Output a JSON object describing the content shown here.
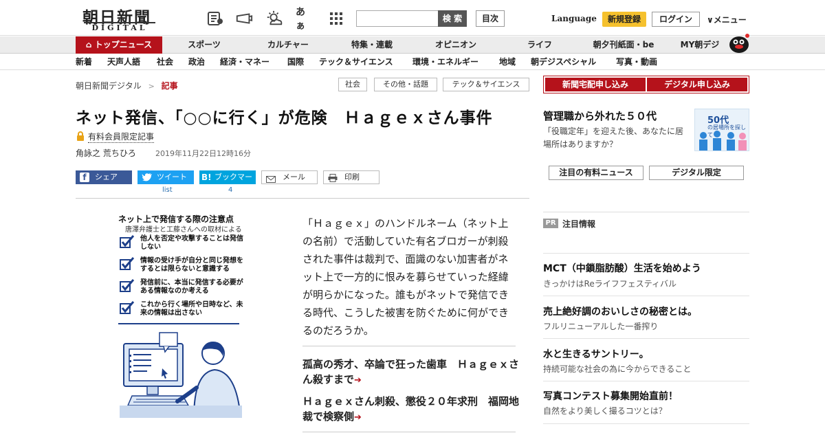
{
  "header": {
    "logo_main": "朝日新聞",
    "logo_sub": "DIGITAL",
    "kana_icon_text": "あぁ",
    "search_button": "検 索",
    "index_button": "目次",
    "language": "Language",
    "signup": "新規登録",
    "login": "ログイン",
    "menu": "∨メニュー"
  },
  "nav_primary": [
    "トップニュース",
    "スポーツ",
    "カルチャー",
    "特集・連載",
    "オピニオン",
    "ライフ",
    "朝夕刊紙面・be",
    "MY朝デジ"
  ],
  "nav_secondary": [
    "新着",
    "天声人語",
    "社会",
    "政治",
    "経済・マネー",
    "国際",
    "テック＆サイエンス",
    "環境・エネルギー",
    "地域",
    "朝デジスペシャル",
    "写真・動画"
  ],
  "breadcrumb": {
    "home": "朝日新聞デジタル",
    "sep": ">",
    "current": "記事"
  },
  "tags": [
    "社会",
    "その他・話題",
    "テック＆サイエンス"
  ],
  "article": {
    "title": "ネット発信、「○○に行く」が危険　Ｈａｇｅｘさん事件",
    "paid_label": "有料会員限定記事",
    "author": "角詠之 荒ちひろ",
    "date": "2019年11月22日12時16分",
    "share": {
      "facebook": "シェア",
      "twitter": "ツイート",
      "hatena": "ブックマーク",
      "hatena_mark": "B!",
      "mail": "メール",
      "print": "印刷",
      "twitter_count": "list",
      "hatena_count": "4"
    },
    "body": "「Ｈａｇｅｘ」のハンドルネーム（ネット上の名前）で活動していた有名ブロガーが刺殺された事件は裁判で、面識のない加害者がネット上で一方的に恨みを募らせていった経緯が明らかになった。誰もがネットで発信できる時代、こうした被害を防ぐために何ができるのだろうか。",
    "related": [
      "孤高の秀才、卒論で狂った歯車　Ｈａｇｅｘさん殺すまで",
      "Ｈａｇｅｘさん刺殺、懲役２０年求刑　福岡地裁で検察側"
    ],
    "arrow": "➔"
  },
  "illustration": {
    "title": "ネット上で発信する際の注意点",
    "subtitle": "唐澤弁護士と工藤さんへの取材による",
    "items": [
      "他人を否定や攻撃することは発信しない",
      "情報の受け手が自分と同じ発想をするとは限らないと意識する",
      "発信前に、本当に発信する必要がある情報なのか考える",
      "これから行く場所や日時など、未来の情報は出さない"
    ]
  },
  "sidebar": {
    "buttons": [
      "新聞宅配申し込み",
      "デジタル申し込み"
    ],
    "ad": {
      "title": "管理職から外れた５０代",
      "desc": "「役職定年」を迎えた後、あなたに居場所はありますか？",
      "img_label": "50代",
      "img_sub": "の居場所を探して"
    },
    "tabs": [
      "注目の有料ニュース",
      "デジタル限定"
    ],
    "pr_badge": "PR",
    "pr_title": "注目情報",
    "pr_items": [
      {
        "head": "MCT（中鎖脂肪酸）生活を始めよう",
        "sub": "きっかけはReライフフェスティバル"
      },
      {
        "head": "売上絶好調のおいしさの秘密とは。",
        "sub": "フルリニューアルした一番搾り"
      },
      {
        "head": "水と生きるサントリー。",
        "sub": "持続可能な社会の為に今からできること"
      },
      {
        "head": "写真コンテスト募集開始直前！",
        "sub": "自然をより美しく撮るコツとは？"
      }
    ]
  },
  "colors": {
    "accent": "#b5121b",
    "signup": "#f5c12e",
    "facebook": "#3b5998",
    "twitter": "#1da1f2",
    "hatena": "#00a4de"
  }
}
